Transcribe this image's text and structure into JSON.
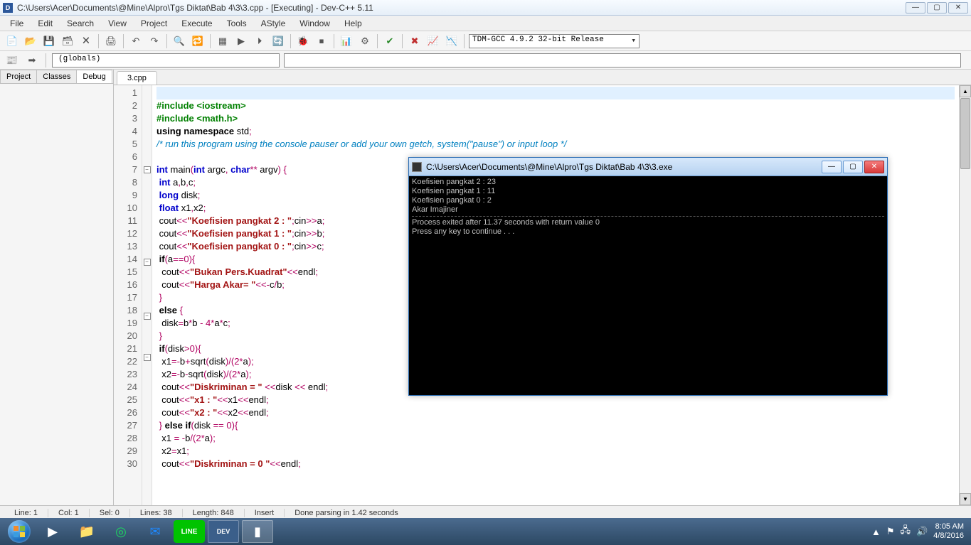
{
  "window": {
    "title": "C:\\Users\\Acer\\Documents\\@Mine\\Alpro\\Tgs Diktat\\Bab 4\\3\\3.cpp - [Executing] - Dev-C++ 5.11"
  },
  "menu": [
    "File",
    "Edit",
    "Search",
    "View",
    "Project",
    "Execute",
    "Tools",
    "AStyle",
    "Window",
    "Help"
  ],
  "compiler_combo": "TDM-GCC 4.9.2 32-bit Release",
  "globals_combo": "(globals)",
  "left_tabs": [
    {
      "label": "Project",
      "active": false
    },
    {
      "label": "Classes",
      "active": false
    },
    {
      "label": "Debug",
      "active": true
    }
  ],
  "file_tab": "3.cpp",
  "code": {
    "lines": [
      {
        "n": 1,
        "raw": ""
      },
      {
        "n": 2,
        "raw": "#include <iostream>"
      },
      {
        "n": 3,
        "raw": "#include <math.h>"
      },
      {
        "n": 4,
        "raw": "using namespace std;"
      },
      {
        "n": 5,
        "raw": "/* run this program using the console pauser or add your own getch, system(\"pause\") or input loop */"
      },
      {
        "n": 6,
        "raw": ""
      },
      {
        "n": 7,
        "raw": "int main(int argc, char** argv) {",
        "fold": true
      },
      {
        "n": 8,
        "raw": " int a,b,c;"
      },
      {
        "n": 9,
        "raw": " long disk;"
      },
      {
        "n": 10,
        "raw": " float x1,x2;"
      },
      {
        "n": 11,
        "raw": " cout<<\"Koefisien pangkat 2 : \";cin>>a;"
      },
      {
        "n": 12,
        "raw": " cout<<\"Koefisien pangkat 1 : \";cin>>b;"
      },
      {
        "n": 13,
        "raw": " cout<<\"Koefisien pangkat 0 : \";cin>>c;"
      },
      {
        "n": 14,
        "raw": " if(a==0){",
        "fold": true
      },
      {
        "n": 15,
        "raw": "  cout<<\"Bukan Pers.Kuadrat\"<<endl;"
      },
      {
        "n": 16,
        "raw": "  cout<<\"Harga Akar= \"<<-c/b;"
      },
      {
        "n": 17,
        "raw": " }"
      },
      {
        "n": 18,
        "raw": " else {",
        "fold": true
      },
      {
        "n": 19,
        "raw": "  disk=b*b - 4*a*c;"
      },
      {
        "n": 20,
        "raw": " }"
      },
      {
        "n": 21,
        "raw": " if(disk>0){",
        "fold": true
      },
      {
        "n": 22,
        "raw": "  x1=-b+sqrt(disk)/(2*a);"
      },
      {
        "n": 23,
        "raw": "  x2=-b-sqrt(disk)/(2*a);"
      },
      {
        "n": 24,
        "raw": "  cout<<\"Diskriminan = \" <<disk << endl;"
      },
      {
        "n": 25,
        "raw": "  cout<<\"x1 : \"<<x1<<endl;"
      },
      {
        "n": 26,
        "raw": "  cout<<\"x2 : \"<<x2<<endl;"
      },
      {
        "n": 27,
        "raw": " } else if(disk == 0){"
      },
      {
        "n": 28,
        "raw": "  x1 = -b/(2*a);"
      },
      {
        "n": 29,
        "raw": "  x2=x1;"
      },
      {
        "n": 30,
        "raw": "  cout<<\"Diskriminan = 0 \"<<endl;"
      }
    ]
  },
  "status": {
    "line": "Line:   1",
    "col": "Col:   1",
    "sel": "Sel:   0",
    "lines": "Lines:   38",
    "length": "Length:   848",
    "mode": "Insert",
    "msg": "Done parsing in 1.42 seconds"
  },
  "console": {
    "title": "C:\\Users\\Acer\\Documents\\@Mine\\Alpro\\Tgs Diktat\\Bab 4\\3\\3.exe",
    "lines": [
      "Koefisien pangkat 2 : 23",
      "Koefisien pangkat 1 : 11",
      "Koefisien pangkat 0 : 2",
      "Akar Imajiner",
      "---",
      "Process exited after 11.37 seconds with return value 0",
      "Press any key to continue . . ."
    ]
  },
  "tray": {
    "time": "8:05 AM",
    "date": "4/8/2016"
  }
}
